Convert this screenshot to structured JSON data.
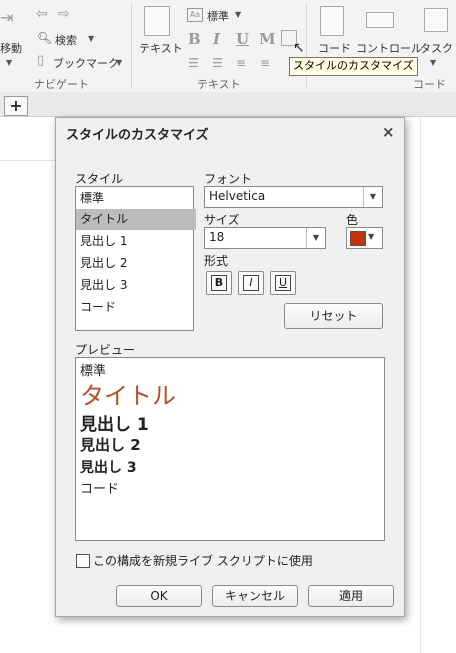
{
  "ribbon": {
    "nav": {
      "move_label": "移動",
      "search_label": "検索",
      "bookmark_label": "ブックマーク",
      "section_label": "ナビゲート"
    },
    "text": {
      "text_button_label": "テキスト",
      "style_dropdown_label": "標準",
      "section_label": "テキスト"
    },
    "code": {
      "code_label": "コード",
      "control_label": "コントロール",
      "task_label": "タスク",
      "section_label": "コード"
    }
  },
  "tooltip": "スタイルのカスタマイズ",
  "tab_add_label": "+",
  "dialog": {
    "title": "スタイルのカスタマイズ",
    "close_label": "×",
    "style_label": "スタイル",
    "styles": [
      "標準",
      "タイトル",
      "見出し 1",
      "見出し 2",
      "見出し 3",
      "コード"
    ],
    "selected_style_index": 1,
    "font_label": "フォント",
    "font_value": "Helvetica",
    "size_label": "サイズ",
    "size_value": "18",
    "color_label": "色",
    "color_value": "#c8330c",
    "format_label": "形式",
    "format_buttons": [
      "B",
      "I",
      "U"
    ],
    "reset_label": "リセット",
    "preview_label": "プレビュー",
    "preview_lines": [
      "標準",
      "タイトル",
      "見出し 1",
      "見出し 2",
      "見出し 3",
      "コード"
    ],
    "title_color": "#b5512a",
    "checkbox_label": "この構成を新規ライブ スクリプトに使用",
    "checkbox_checked": false,
    "ok_label": "OK",
    "cancel_label": "キャンセル",
    "apply_label": "適用"
  }
}
